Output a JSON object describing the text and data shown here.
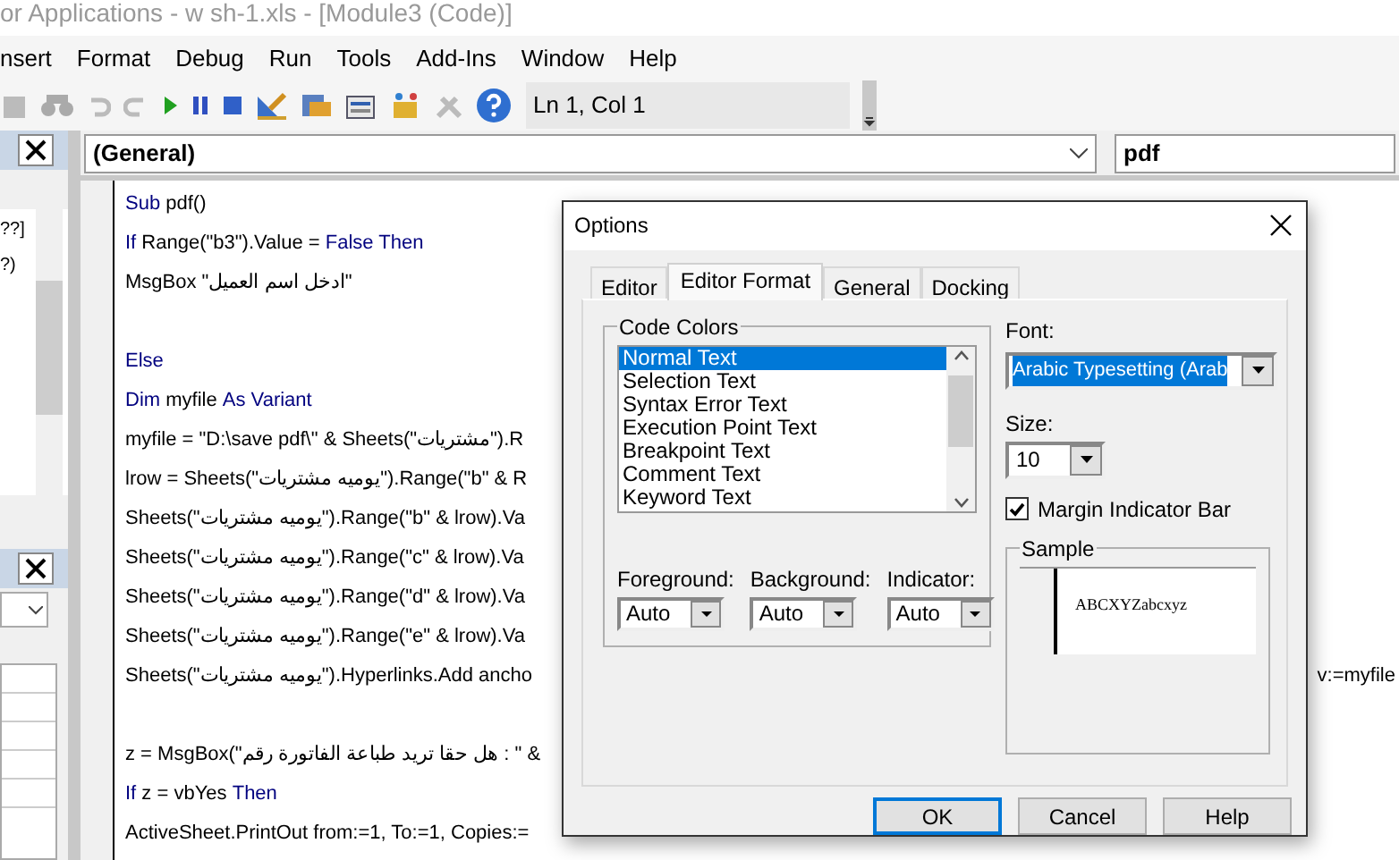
{
  "window": {
    "title": "or Applications - w sh-1.xls - [Module3 (Code)]"
  },
  "menu": [
    "nsert",
    "Format",
    "Debug",
    "Run",
    "Tools",
    "Add-Ins",
    "Window",
    "Help"
  ],
  "toolbar": {
    "position": "Ln 1, Col 1"
  },
  "project_panel": {
    "items": [
      "??]",
      "?)"
    ]
  },
  "code_window": {
    "object": "(General)",
    "procedure": "pdf",
    "lines": [
      {
        "kind": "code",
        "segments": [
          {
            "text": "Sub",
            "keyword": true
          },
          {
            "text": " pdf()",
            "keyword": false
          }
        ]
      },
      {
        "kind": "code",
        "segments": [
          {
            "text": "If",
            "keyword": true
          },
          {
            "text": " Range(\"b3\").Value = ",
            "keyword": false
          },
          {
            "text": "False Then",
            "keyword": true
          }
        ]
      },
      {
        "kind": "code",
        "segments": [
          {
            "text": "MsgBox \"ادخل اسم العميل\"",
            "keyword": false
          }
        ]
      },
      {
        "kind": "blank"
      },
      {
        "kind": "code",
        "segments": [
          {
            "text": "Else",
            "keyword": true
          }
        ]
      },
      {
        "kind": "code",
        "segments": [
          {
            "text": "Dim",
            "keyword": true
          },
          {
            "text": " myfile ",
            "keyword": false
          },
          {
            "text": "As Variant",
            "keyword": true
          }
        ]
      },
      {
        "kind": "code",
        "segments": [
          {
            "text": "myfile = \"D:\\save pdf\\\" & Sheets(\"مشتريات\").R",
            "keyword": false
          }
        ]
      },
      {
        "kind": "code",
        "segments": [
          {
            "text": "lrow = Sheets(\"يوميه مشتريات\").Range(\"b\" & R",
            "keyword": false
          }
        ]
      },
      {
        "kind": "code",
        "segments": [
          {
            "text": "Sheets(\"يوميه مشتريات\").Range(\"b\" & lrow).Va",
            "keyword": false
          }
        ]
      },
      {
        "kind": "code",
        "segments": [
          {
            "text": "Sheets(\"يوميه مشتريات\").Range(\"c\" & lrow).Va",
            "keyword": false
          }
        ]
      },
      {
        "kind": "code",
        "segments": [
          {
            "text": "Sheets(\"يوميه مشتريات\").Range(\"d\" & lrow).Va",
            "keyword": false
          }
        ]
      },
      {
        "kind": "code",
        "segments": [
          {
            "text": "Sheets(\"يوميه مشتريات\").Range(\"e\" & lrow).Va",
            "keyword": false
          }
        ]
      },
      {
        "kind": "code",
        "segments": [
          {
            "text": "Sheets(\"يوميه مشتريات\").Hyperlinks.Add ancho",
            "keyword": false
          }
        ],
        "tail": "v:=myfile"
      },
      {
        "kind": "blank"
      },
      {
        "kind": "code",
        "segments": [
          {
            "text": "z = MsgBox(\"هل حقا تريد طباعة الفاتورة رقم : \" &",
            "keyword": false
          }
        ]
      },
      {
        "kind": "code",
        "segments": [
          {
            "text": "If",
            "keyword": true
          },
          {
            "text": " z = vbYes ",
            "keyword": false
          },
          {
            "text": "Then",
            "keyword": true
          }
        ]
      },
      {
        "kind": "code",
        "segments": [
          {
            "text": "ActiveSheet.PrintOut from:=1, To:=1, Copies:=",
            "keyword": false
          }
        ]
      }
    ]
  },
  "dialog": {
    "title": "Options",
    "tabs": [
      {
        "label": "Editor",
        "selected": false
      },
      {
        "label": "Editor Format",
        "selected": true
      },
      {
        "label": "General",
        "selected": false
      },
      {
        "label": "Docking",
        "selected": false
      }
    ],
    "code_colors": {
      "label": "Code Colors",
      "items": [
        {
          "label": "Normal Text",
          "selected": true
        },
        {
          "label": "Selection Text",
          "selected": false
        },
        {
          "label": "Syntax Error Text",
          "selected": false
        },
        {
          "label": "Execution Point Text",
          "selected": false
        },
        {
          "label": "Breakpoint Text",
          "selected": false
        },
        {
          "label": "Comment Text",
          "selected": false
        },
        {
          "label": "Keyword Text",
          "selected": false
        }
      ]
    },
    "color_pickers": [
      {
        "label": "Foreground:",
        "value": "Auto"
      },
      {
        "label": "Background:",
        "value": "Auto"
      },
      {
        "label": "Indicator:",
        "value": "Auto"
      }
    ],
    "font": {
      "label": "Font:",
      "value": "Arabic Typesetting (Arab"
    },
    "size": {
      "label": "Size:",
      "value": "10"
    },
    "margin_indicator_bar": {
      "label": "Margin Indicator Bar",
      "checked": true
    },
    "sample": {
      "label": "Sample",
      "text": "ABCXYZabcxyz"
    },
    "buttons": [
      {
        "label": "OK",
        "default": true
      },
      {
        "label": "Cancel",
        "default": false
      },
      {
        "label": "Help",
        "default": false
      }
    ]
  }
}
